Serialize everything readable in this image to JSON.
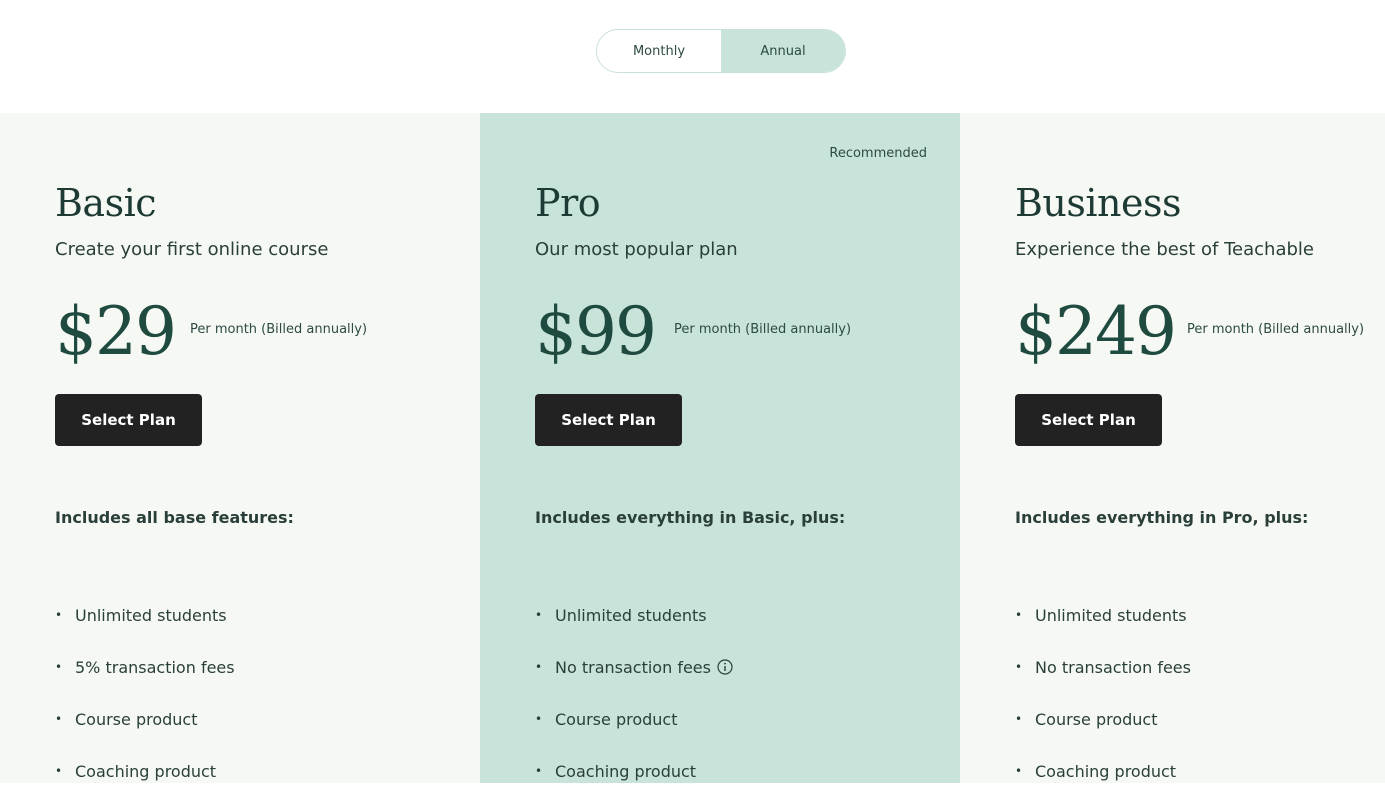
{
  "billing_toggle": {
    "monthly_label": "Monthly",
    "annual_label": "Annual",
    "selected": "Annual"
  },
  "plans": [
    {
      "name": "Basic",
      "tagline": "Create your first online course",
      "price": "$29",
      "price_note": "Per month (Billed annually)",
      "button_label": "Select Plan",
      "includes_heading": "Includes all base features:",
      "features": [
        "Unlimited students",
        "5% transaction fees",
        "Course product",
        "Coaching product"
      ]
    },
    {
      "name": "Pro",
      "badge": "Recommended",
      "tagline": "Our most popular plan",
      "price": "$99",
      "price_note": "Per month (Billed annually)",
      "button_label": "Select Plan",
      "includes_heading": "Includes everything in Basic, plus:",
      "features": [
        "Unlimited students",
        "No transaction fees",
        "Course product",
        "Coaching product"
      ]
    },
    {
      "name": "Business",
      "tagline": "Experience the best of Teachable",
      "price": "$249",
      "price_note": "Per month (Billed annually)",
      "button_label": "Select Plan",
      "includes_heading": "Includes everything in Pro, plus:",
      "features": [
        "Unlimited students",
        "No transaction fees",
        "Course product",
        "Coaching product"
      ]
    }
  ],
  "colors": {
    "toggle_active_bg": "#c8e3d9",
    "pro_column_bg": "#c8e3d9",
    "column_bg": "#f6f9f3",
    "button_bg": "#222222",
    "heading_text": "#1e3a34"
  }
}
